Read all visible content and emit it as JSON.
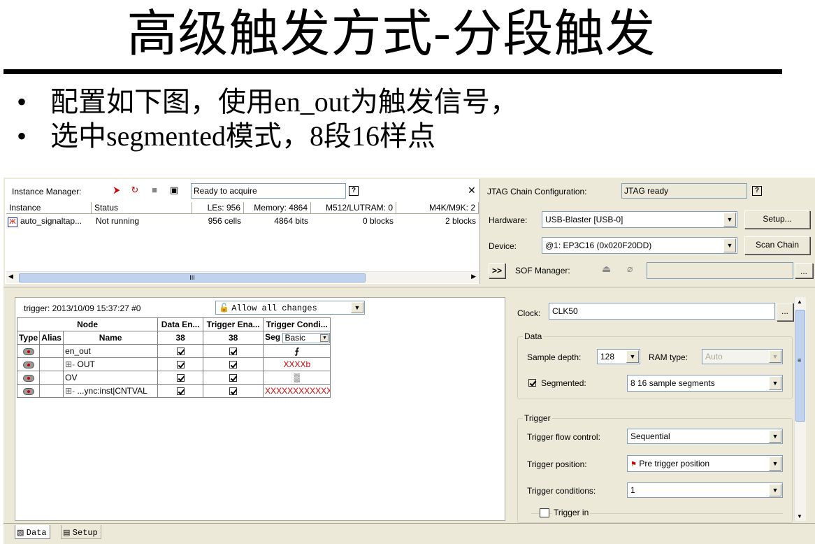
{
  "slide": {
    "title": "高级触发方式-分段触发",
    "bullets": [
      "配置如下图，使用en_out为触发信号，",
      "选中segmented模式，8段16样点"
    ],
    "bullet_glyph": "•"
  },
  "instance_manager": {
    "label": "Instance Manager:",
    "status": "Ready to acquire",
    "columns": [
      "Instance",
      "Status",
      "LEs: 956",
      "Memory: 4864",
      "M512/LUTRAM: 0",
      "M4K/M9K: 2"
    ],
    "row": {
      "instance": "auto_signaltap...",
      "status": "Not running",
      "les": "956 cells",
      "memory": "4864 bits",
      "m512": "0 blocks",
      "m4k": "2 blocks"
    },
    "scroll_grip": "III"
  },
  "jtag": {
    "label": "JTAG Chain Configuration:",
    "status": "JTAG ready",
    "hardware_label": "Hardware:",
    "hardware_value": "USB-Blaster [USB-0]",
    "setup_button": "Setup...",
    "device_label": "Device:",
    "device_value": "@1: EP3C16 (0x020F20DD)",
    "scan_chain_button": "Scan Chain",
    "expand_button": ">>",
    "sof_label": "SOF Manager:",
    "sof_browse": "..."
  },
  "signals": {
    "trigger_info": "trigger: 2013/10/09 15:37:27  #0",
    "storage_qualifier": "Allow all changes",
    "headers_top": [
      "Node",
      "Data En...",
      "Trigger Ena...",
      "Trigger Condi..."
    ],
    "headers_sub": [
      "Type",
      "Alias",
      "Name",
      "38",
      "38",
      "Seg"
    ],
    "condition_mode": "Basic",
    "rows": [
      {
        "name": "en_out",
        "expander": "",
        "condition": "⨍",
        "red": false
      },
      {
        "name": "OUT",
        "expander": "⊞-",
        "condition": "XXXXb",
        "red": true
      },
      {
        "name": "OV",
        "expander": "",
        "condition": "▒",
        "red": false
      },
      {
        "name": "...ync:inst|CNTVAL",
        "expander": "⊞- ",
        "condition": "XXXXXXXXXXXX...",
        "red": true
      }
    ]
  },
  "setup": {
    "clock_label": "Clock:",
    "clock_value": "CLK50",
    "clock_browse": "...",
    "data_group": "Data",
    "sample_depth_label": "Sample depth:",
    "sample_depth_value": "128",
    "ram_type_label": "RAM type:",
    "ram_type_value": "Auto",
    "segmented_label": "Segmented:",
    "segmented_value": "8  16 sample segments",
    "trigger_group": "Trigger",
    "flow_label": "Trigger flow control:",
    "flow_value": "Sequential",
    "position_label": "Trigger position:",
    "position_value": "Pre trigger position",
    "conditions_label": "Trigger conditions:",
    "conditions_value": "1",
    "trigger_in_label": "Trigger in"
  },
  "tabs": [
    "Data",
    "Setup"
  ]
}
